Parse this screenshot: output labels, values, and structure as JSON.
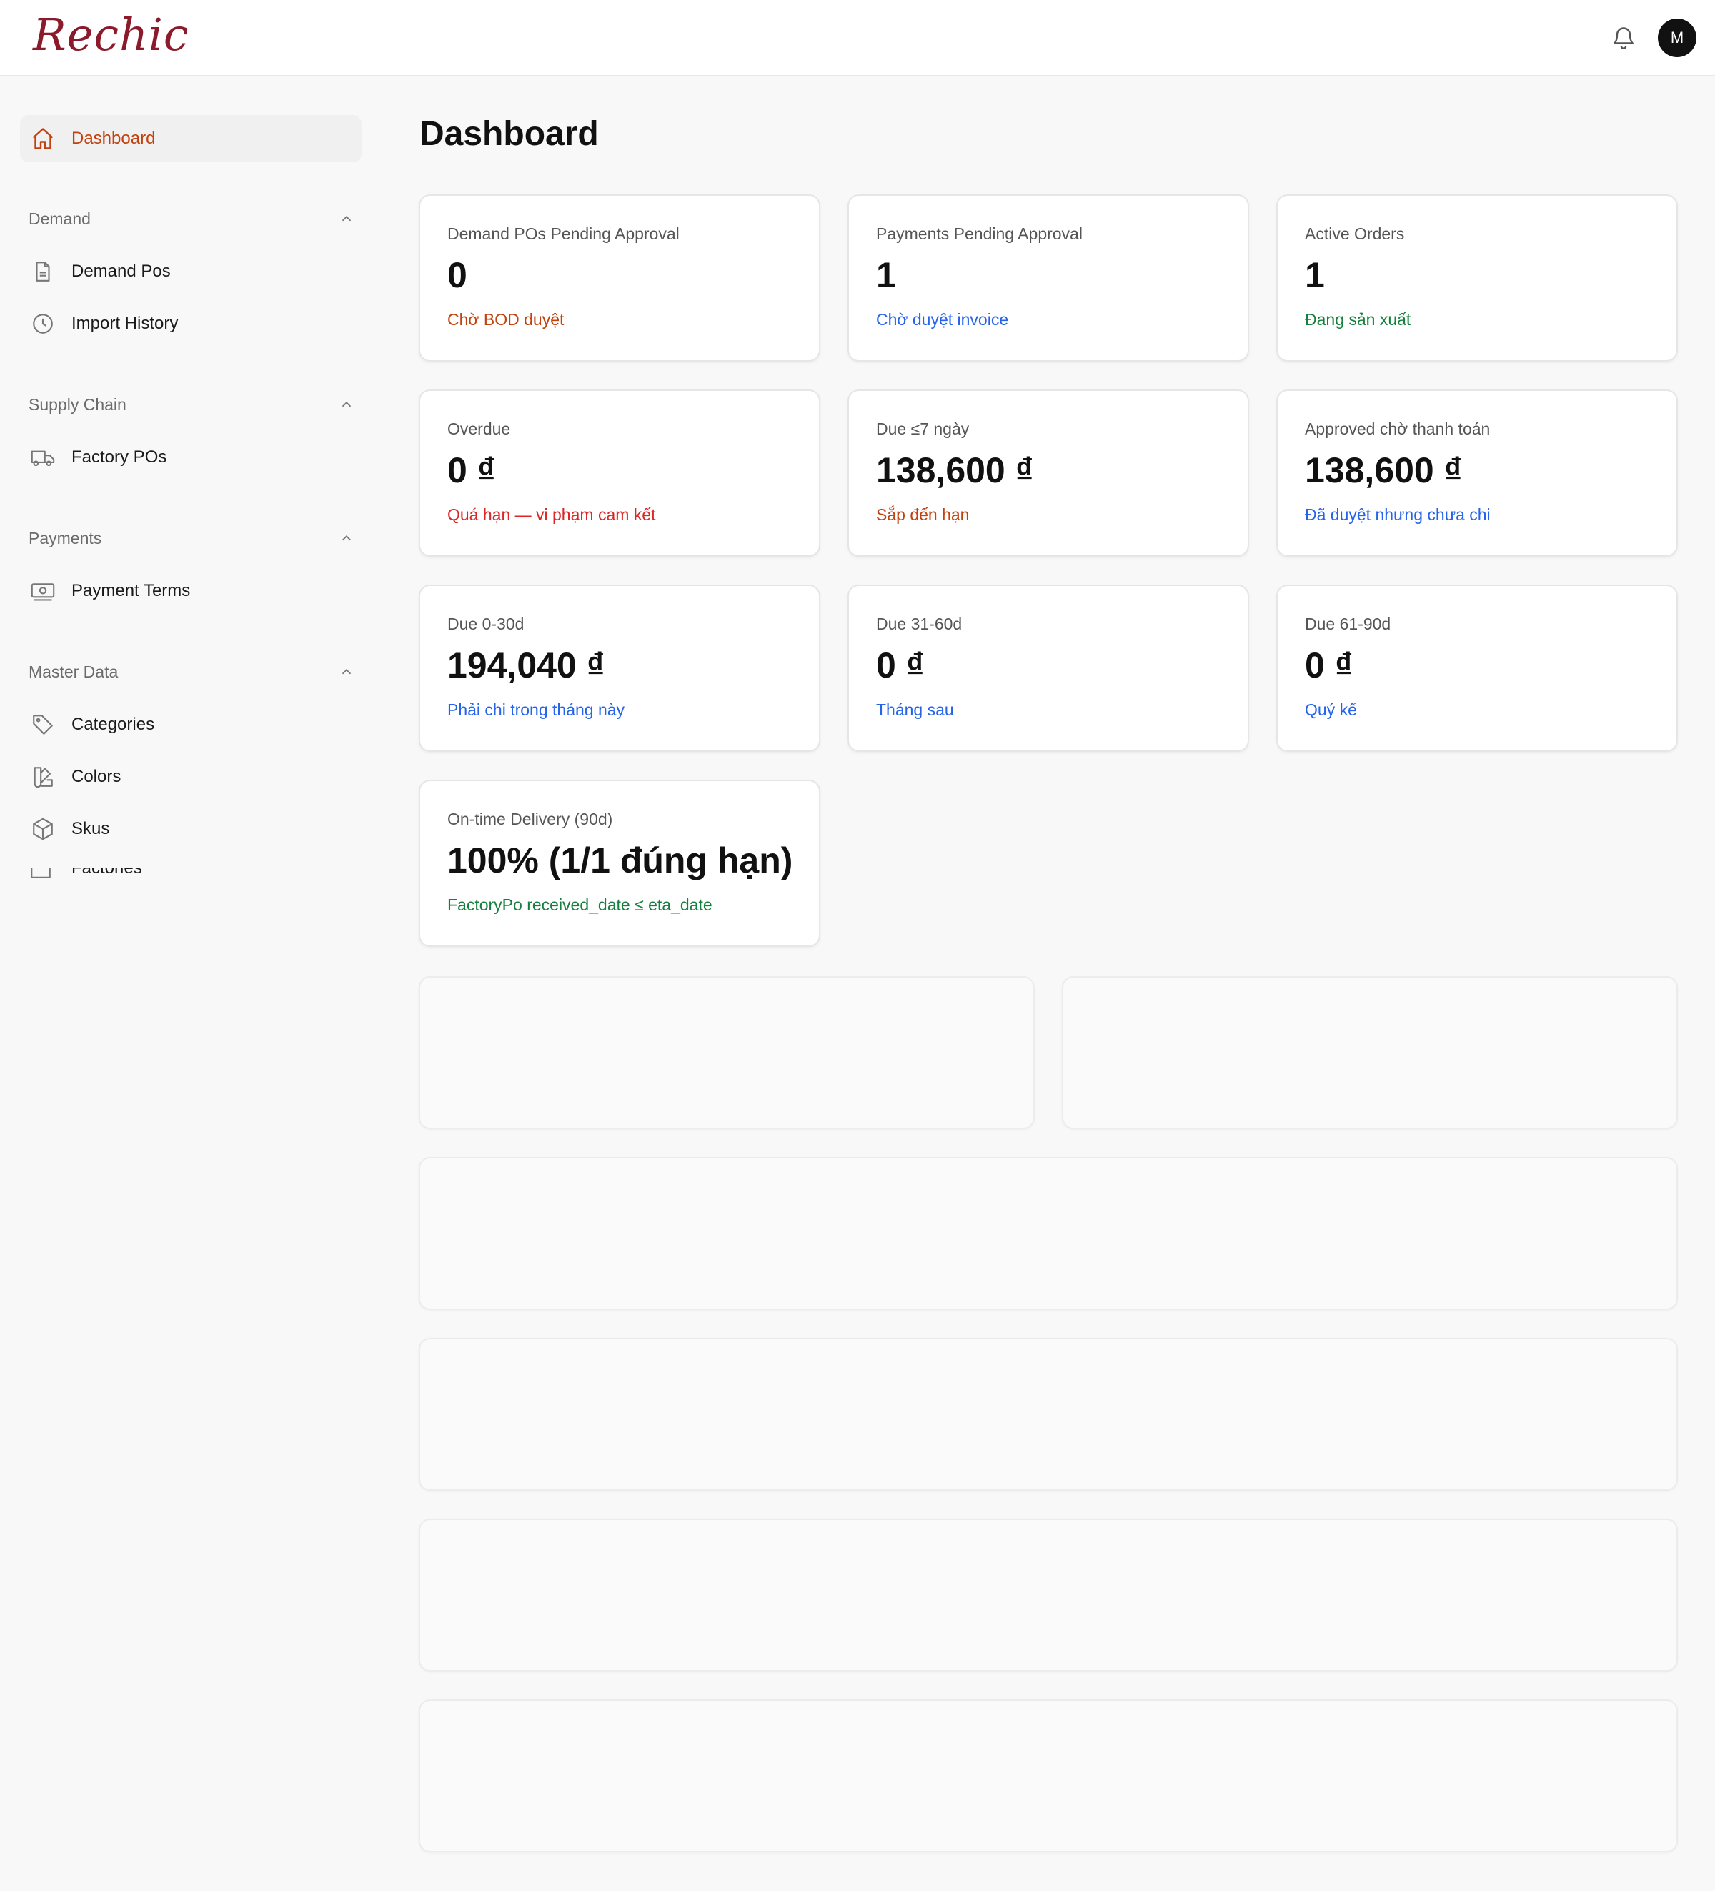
{
  "app": {
    "logo_text": "Rechic",
    "avatar_initial": "M"
  },
  "sidebar": {
    "dashboard_label": "Dashboard",
    "sections": [
      {
        "title": "Demand",
        "items": [
          "Demand Pos",
          "Import History"
        ]
      },
      {
        "title": "Supply Chain",
        "items": [
          "Factory POs"
        ]
      },
      {
        "title": "Payments",
        "items": [
          "Payment Terms"
        ]
      },
      {
        "title": "Master Data",
        "items": [
          "Categories",
          "Colors",
          "Skus",
          "Factories"
        ]
      }
    ]
  },
  "page": {
    "title": "Dashboard"
  },
  "cards": [
    {
      "label": "Demand POs Pending Approval",
      "value": "0",
      "sub": "Chờ BOD duyệt",
      "color": "#c2410c"
    },
    {
      "label": "Payments Pending Approval",
      "value": "1",
      "sub": "Chờ duyệt invoice",
      "color": "#2563eb"
    },
    {
      "label": "Active Orders",
      "value": "1",
      "sub": "Đang sản xuất",
      "color": "#15803d"
    },
    {
      "label": "Overdue",
      "value": "0 ₫",
      "sub": "Quá hạn — vi phạm cam kết",
      "color": "#dc2626"
    },
    {
      "label": "Due ≤7 ngày",
      "value": "138,600 ₫",
      "sub": "Sắp đến hạn",
      "color": "#c2410c"
    },
    {
      "label": "Approved chờ thanh toán",
      "value": "138,600 ₫",
      "sub": "Đã duyệt nhưng chưa chi",
      "color": "#2563eb"
    },
    {
      "label": "Due 0-30d",
      "value": "194,040 ₫",
      "sub": "Phải chi trong tháng này",
      "color": "#2563eb"
    },
    {
      "label": "Due 31-60d",
      "value": "0 ₫",
      "sub": "Tháng sau",
      "color": "#2563eb"
    },
    {
      "label": "Due 61-90d",
      "value": "0 ₫",
      "sub": "Quý kế",
      "color": "#2563eb"
    },
    {
      "label": "On-time Delivery (90d)",
      "value": "100% (1/1 đúng hạn)",
      "sub": "FactoryPo received_date ≤ eta_date",
      "color": "#15803d"
    }
  ]
}
